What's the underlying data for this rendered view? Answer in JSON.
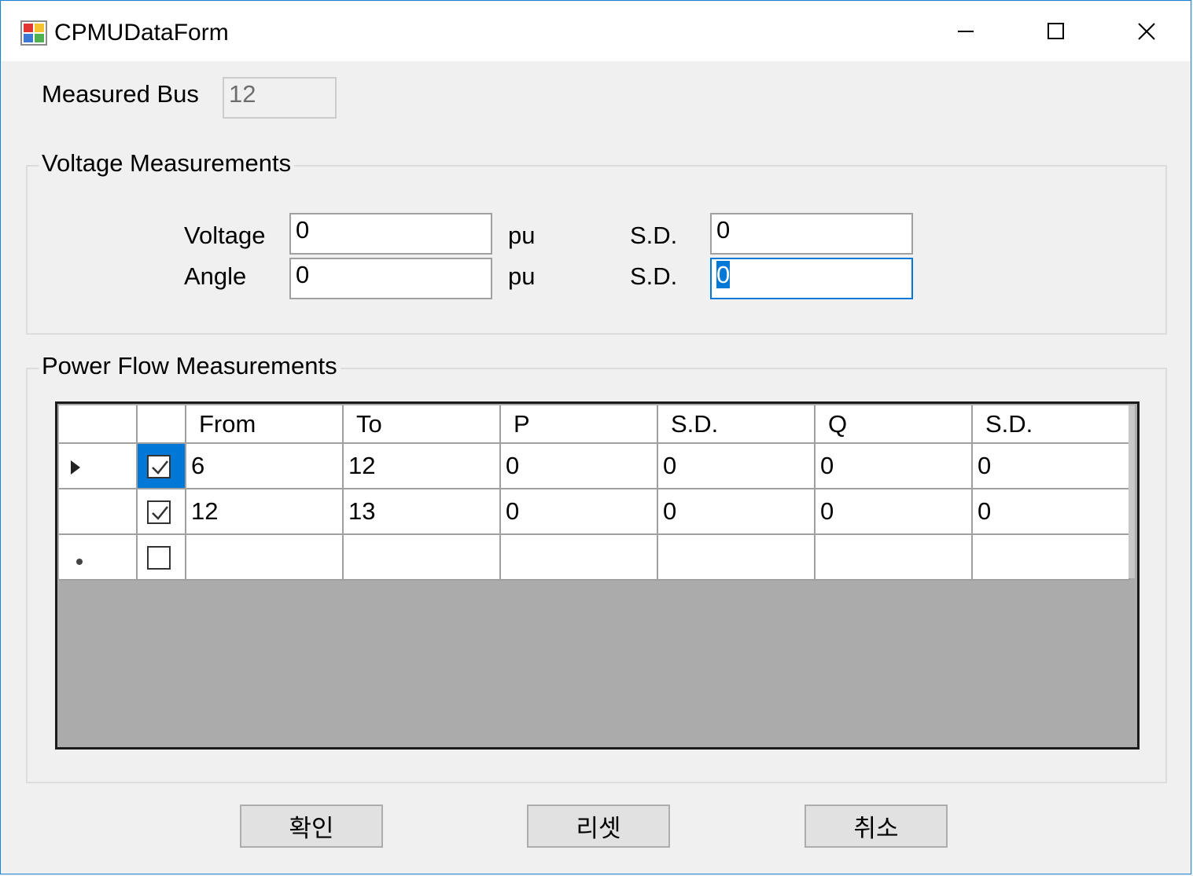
{
  "window": {
    "title": "CPMUDataForm",
    "icon": "form-app-icon",
    "controls": [
      "minimize-icon",
      "maximize-icon",
      "close-icon"
    ]
  },
  "measured_bus": {
    "label": "Measured Bus",
    "value": "12"
  },
  "voltage_group": {
    "title": "Voltage Measurements",
    "voltage": {
      "label": "Voltage",
      "value": "0",
      "unit": "pu",
      "sd_label": "S.D.",
      "sd_value": "0"
    },
    "angle": {
      "label": "Angle",
      "value": "0",
      "unit": "pu",
      "sd_label": "S.D.",
      "sd_value": "0"
    }
  },
  "power_flow_group": {
    "title": "Power Flow Measurements",
    "columns": [
      "From",
      "To",
      "P",
      "S.D.",
      "Q",
      "S.D."
    ],
    "rows": [
      {
        "checked": true,
        "current": true,
        "cells": [
          "6",
          "12",
          "0",
          "0",
          "0",
          "0"
        ]
      },
      {
        "checked": true,
        "current": false,
        "cells": [
          "12",
          "13",
          "0",
          "0",
          "0",
          "0"
        ]
      },
      {
        "checked": false,
        "new_row": true,
        "cells": [
          "",
          "",
          "",
          "",
          "",
          ""
        ]
      }
    ]
  },
  "buttons": {
    "ok": "확인",
    "reset": "리셋",
    "cancel": "취소"
  },
  "colors": {
    "accent": "#0078d7",
    "grid_background": "#ababab",
    "window_bg": "#f0f0f0"
  }
}
